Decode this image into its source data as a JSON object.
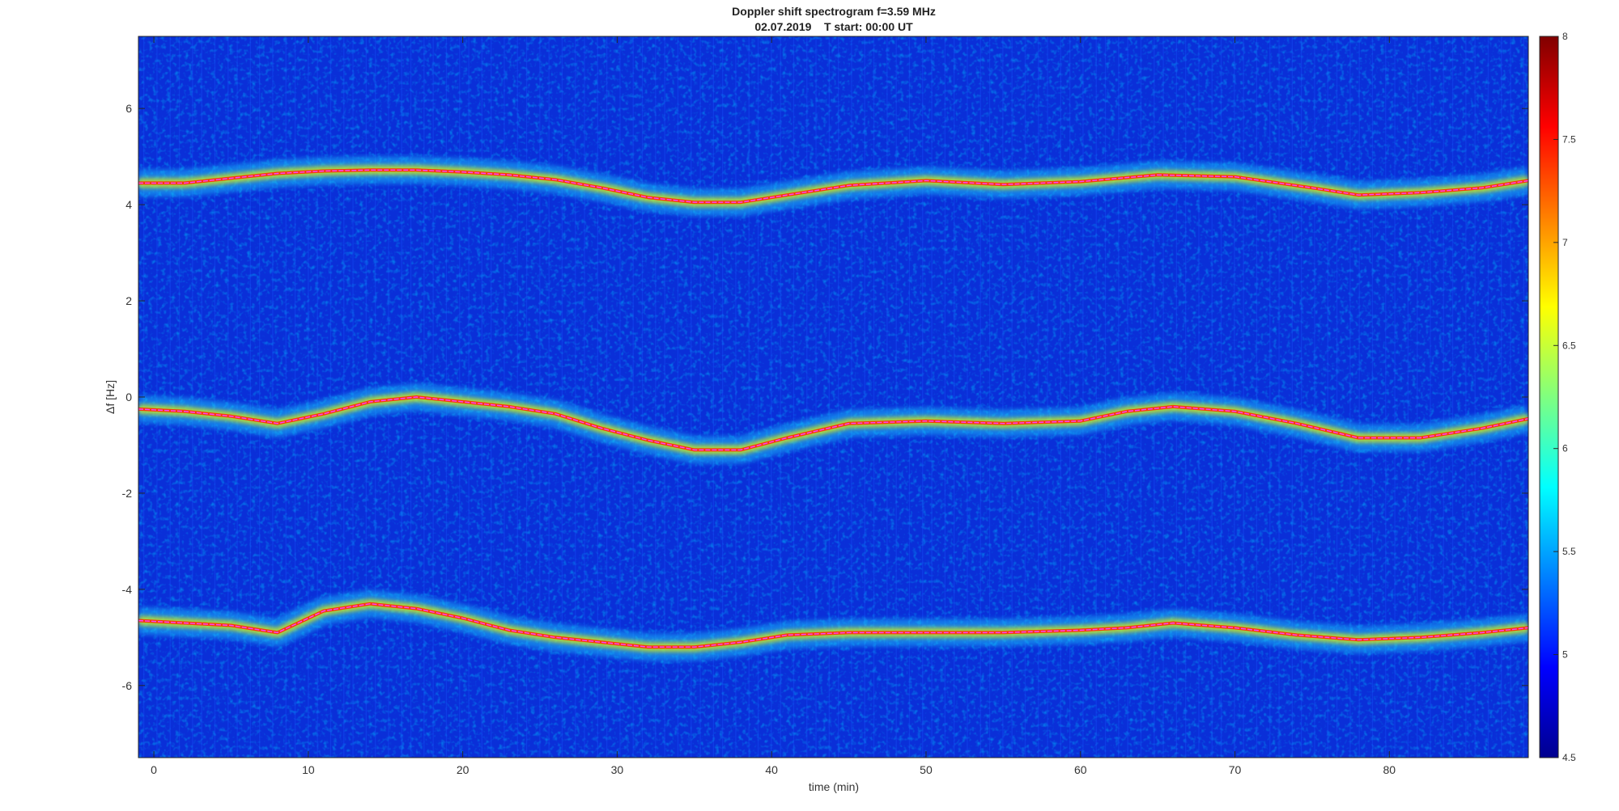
{
  "chart_data": {
    "type": "heatmap",
    "title": "Doppler shift spectrogram f=3.59 MHz",
    "subtitle": "02.07.2019    T start: 00:00 UT",
    "xlabel": "time (min)",
    "ylabel": "Δf [Hz]",
    "xlim": [
      -1,
      89
    ],
    "ylim": [
      -7.5,
      7.5
    ],
    "x_ticks": [
      0,
      10,
      20,
      30,
      40,
      50,
      60,
      70,
      80
    ],
    "y_ticks": [
      -6,
      -4,
      -2,
      0,
      2,
      4,
      6
    ],
    "colorbar": {
      "colormap": "jet",
      "range": [
        4.5,
        8
      ],
      "ticks": [
        4.5,
        5,
        5.5,
        6,
        6.5,
        7,
        7.5,
        8
      ]
    },
    "traces": [
      {
        "trace_x": [
          -1,
          2,
          5,
          8,
          11,
          14,
          17,
          20,
          23,
          26,
          29,
          32,
          35,
          38,
          41,
          45,
          50,
          55,
          60,
          65,
          70,
          75,
          78,
          82,
          86,
          89
        ],
        "trace_y": [
          4.45,
          4.45,
          4.55,
          4.65,
          4.7,
          4.72,
          4.72,
          4.68,
          4.62,
          4.52,
          4.35,
          4.15,
          4.05,
          4.05,
          4.2,
          4.4,
          4.5,
          4.42,
          4.48,
          4.62,
          4.58,
          4.35,
          4.2,
          4.25,
          4.35,
          4.5
        ]
      },
      {
        "trace_x": [
          -1,
          2,
          5,
          8,
          11,
          14,
          17,
          20,
          23,
          26,
          29,
          32,
          35,
          38,
          41,
          45,
          50,
          55,
          60,
          63,
          66,
          70,
          74,
          78,
          82,
          86,
          89
        ],
        "trace_y": [
          -0.25,
          -0.3,
          -0.4,
          -0.55,
          -0.35,
          -0.1,
          0.0,
          -0.1,
          -0.2,
          -0.35,
          -0.65,
          -0.9,
          -1.1,
          -1.1,
          -0.85,
          -0.55,
          -0.5,
          -0.55,
          -0.5,
          -0.3,
          -0.2,
          -0.3,
          -0.55,
          -0.85,
          -0.85,
          -0.65,
          -0.45
        ]
      },
      {
        "trace_x": [
          -1,
          2,
          5,
          8,
          11,
          14,
          17,
          20,
          23,
          26,
          29,
          32,
          35,
          38,
          41,
          45,
          50,
          55,
          60,
          63,
          66,
          70,
          74,
          78,
          82,
          86,
          89
        ],
        "trace_y": [
          -4.65,
          -4.7,
          -4.75,
          -4.9,
          -4.45,
          -4.3,
          -4.4,
          -4.6,
          -4.85,
          -5.0,
          -5.1,
          -5.2,
          -5.2,
          -5.1,
          -4.95,
          -4.9,
          -4.9,
          -4.9,
          -4.85,
          -4.8,
          -4.7,
          -4.8,
          -4.95,
          -5.05,
          -5.0,
          -4.9,
          -4.8
        ]
      }
    ]
  }
}
